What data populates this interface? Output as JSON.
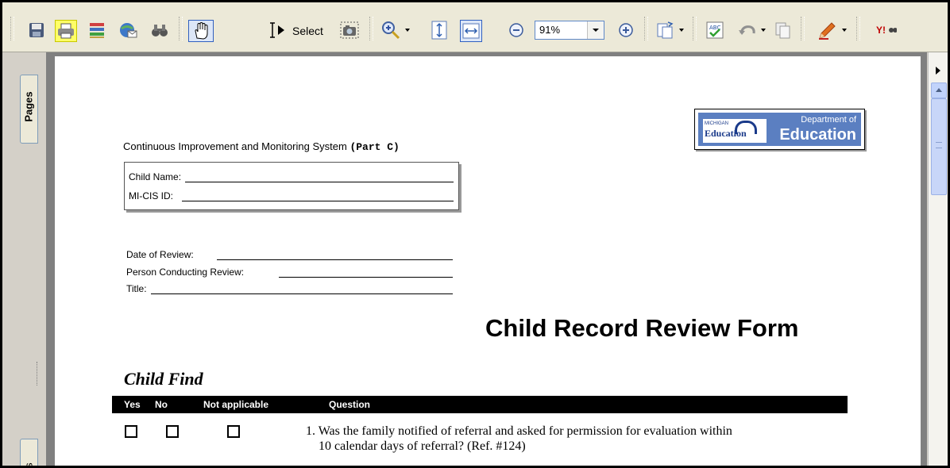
{
  "toolbar": {
    "items": [
      {
        "name": "save-icon"
      },
      {
        "name": "print-icon"
      },
      {
        "name": "organizer-icon"
      },
      {
        "name": "email-icon"
      },
      {
        "name": "search-binoculars-icon"
      },
      {
        "name": "hand-tool-icon"
      },
      {
        "name": "select-tool-icon"
      },
      {
        "name": "snapshot-icon"
      },
      {
        "name": "zoom-in-tool-icon"
      },
      {
        "name": "fit-page-icon"
      },
      {
        "name": "fit-width-icon"
      },
      {
        "name": "zoom-out-icon"
      },
      {
        "name": "zoom-in-icon"
      },
      {
        "name": "rotate-pages-icon"
      },
      {
        "name": "spell-check-icon"
      },
      {
        "name": "undo-icon"
      },
      {
        "name": "copy-icon"
      },
      {
        "name": "pen-icon"
      },
      {
        "name": "yahoo-icon"
      }
    ],
    "select_label": "Select",
    "zoom_value": "91%"
  },
  "side_panel": {
    "pages_tab": "Pages",
    "bottom_tab": "ts"
  },
  "document": {
    "subtitle": "Continuous Improvement and Monitoring System",
    "subtitle_bold": "(Part C)",
    "logo": {
      "michigan": "MICHIGAN",
      "education_small": "Education",
      "department": "Department of",
      "education_large": "Education"
    },
    "child_name_label": "Child Name:",
    "mi_cis_label": "MI-CIS ID:",
    "date_of_review_label": "Date of Review:",
    "person_conducting_label": "Person Conducting Review:",
    "title_label": "Title:",
    "form_title": "Child Record Review Form",
    "section_title": "Child Find",
    "table_headers": [
      "Yes",
      "No",
      "Not applicable",
      "Question"
    ],
    "questions": [
      {
        "number": "1.",
        "text_line1": "Was the family notified of referral and asked for permission for evaluation within",
        "text_line2": "10 calendar days of referral? (Ref. #124)"
      }
    ]
  },
  "colors": {
    "toolbar_bg": "#ece9d8",
    "highlight": "#ffff66",
    "viewport_bg": "#808080",
    "logo_blue": "#5b7fc1"
  }
}
